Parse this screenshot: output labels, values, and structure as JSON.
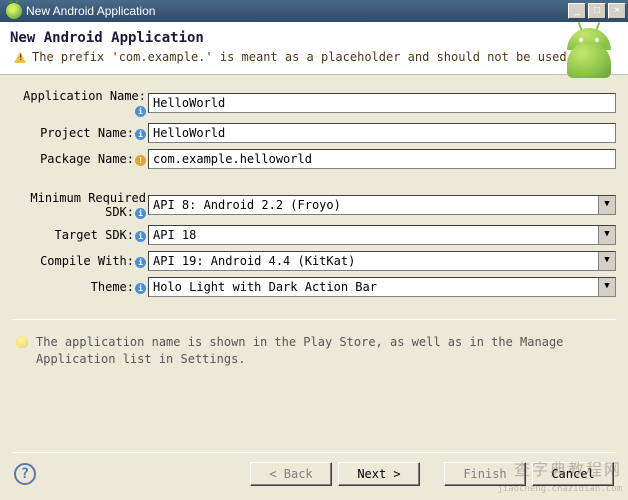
{
  "window": {
    "title": "New Android Application",
    "min": "_",
    "max": "□",
    "close": "×"
  },
  "banner": {
    "heading": "New Android Application",
    "warning": "The prefix 'com.example.' is meant as a placeholder and should not be used"
  },
  "form": {
    "app_name_label": "Application Name:",
    "app_name_value": "HelloWorld",
    "project_name_label": "Project Name:",
    "project_name_value": "HelloWorld",
    "package_name_label": "Package Name:",
    "package_name_value": "com.example.helloworld",
    "min_sdk_label": "Minimum Required SDK:",
    "min_sdk_value": "API 8: Android 2.2 (Froyo)",
    "target_sdk_label": "Target SDK:",
    "target_sdk_value": "API 18",
    "compile_with_label": "Compile With:",
    "compile_with_value": "API 19: Android 4.4 (KitKat)",
    "theme_label": "Theme:",
    "theme_value": "Holo Light with Dark Action Bar"
  },
  "hint": "The application name is shown in the Play Store, as well as in the Manage Application list in Settings.",
  "buttons": {
    "help": "?",
    "back": "< Back",
    "next": "Next >",
    "finish": "Finish",
    "cancel": "Cancel"
  },
  "watermark": {
    "main": "查字典教程网",
    "sub": "jiaocheng.chazidian.com"
  },
  "icons": {
    "info": "i",
    "warn": "!",
    "dropdown": "▼"
  }
}
